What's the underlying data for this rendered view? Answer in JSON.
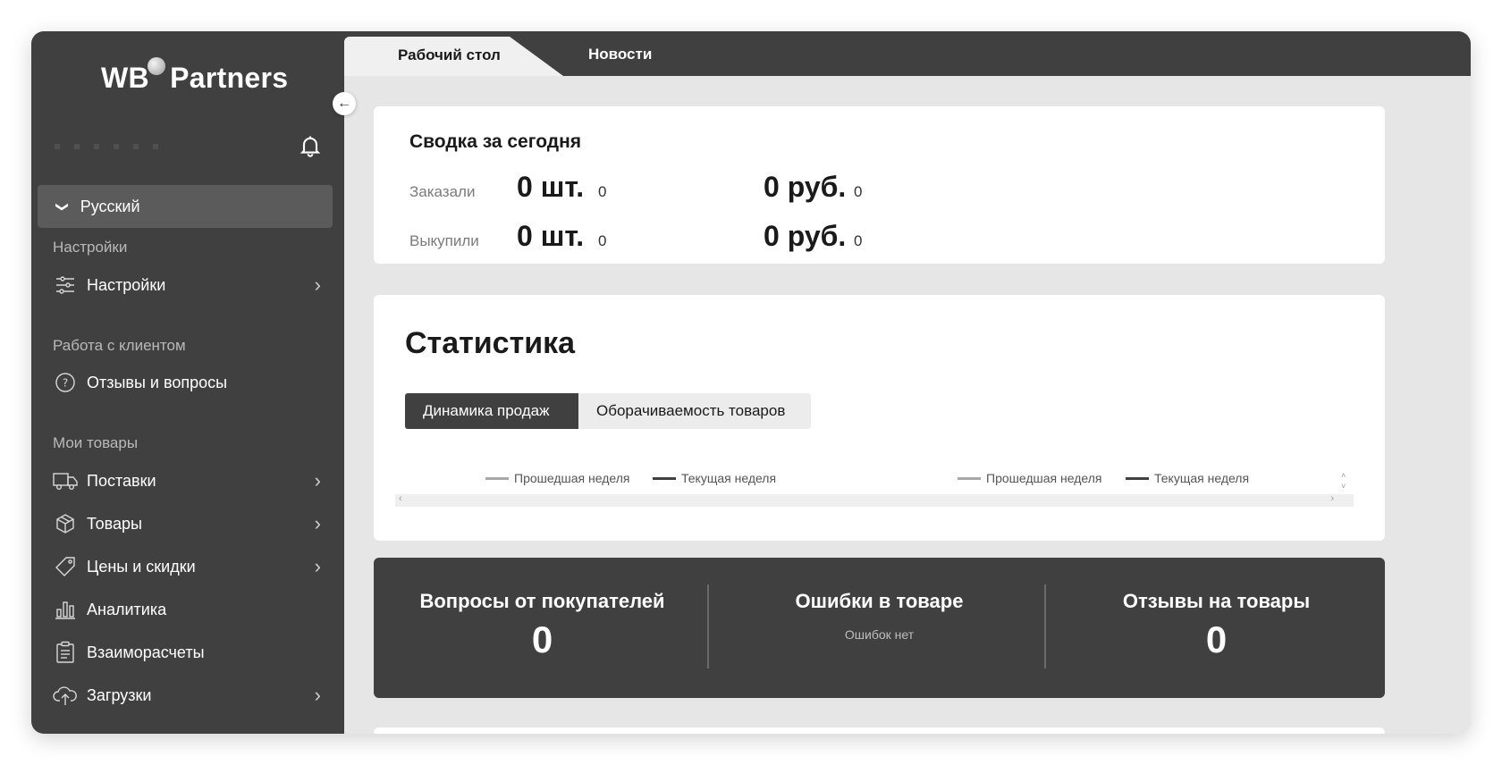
{
  "sidebar": {
    "logo_left": "WB",
    "logo_right": "Partners",
    "language": "Русский",
    "section_settings": "Настройки",
    "item_settings": "Настройки",
    "section_client": "Работа с клиентом",
    "item_reviews": "Отзывы и вопросы",
    "section_goods": "Мои товары",
    "items": [
      {
        "label": "Поставки",
        "icon": "truck-icon",
        "arrow": true
      },
      {
        "label": "Товары",
        "icon": "box-icon",
        "arrow": true
      },
      {
        "label": "Цены и скидки",
        "icon": "price-tag-icon",
        "arrow": true
      },
      {
        "label": "Аналитика",
        "icon": "bar-chart-icon",
        "arrow": false
      },
      {
        "label": "Взаиморасчеты",
        "icon": "clipboard-icon",
        "arrow": false
      },
      {
        "label": "Загрузки",
        "icon": "cloud-upload-icon",
        "arrow": true
      }
    ]
  },
  "tabs": {
    "desktop": "Рабочий стол",
    "news": "Новости"
  },
  "summary": {
    "title": "Сводка за сегодня",
    "ordered_label": "Заказали",
    "ordered_qty": "0 шт.",
    "ordered_qty_delta": "0",
    "ordered_sum": "0 руб.",
    "ordered_sum_delta": "0",
    "bought_label": "Выкупили",
    "bought_qty": "0 шт.",
    "bought_qty_delta": "0",
    "bought_sum": "0 руб.",
    "bought_sum_delta": "0"
  },
  "stats": {
    "title": "Статистика",
    "tab_sales": "Динамика продаж",
    "tab_turnover": "Оборачиваемость товаров",
    "legend_prev": "Прошедшая неделя",
    "legend_curr": "Текущая неделя",
    "colors": {
      "prev": "#a8a8a8",
      "curr": "#404040"
    }
  },
  "metrics": {
    "questions_title": "Вопросы от покупателей",
    "questions_value": "0",
    "errors_title": "Ошибки в товаре",
    "errors_sub": "Ошибок нет",
    "reviews_title": "Отзывы на товары",
    "reviews_value": "0"
  }
}
